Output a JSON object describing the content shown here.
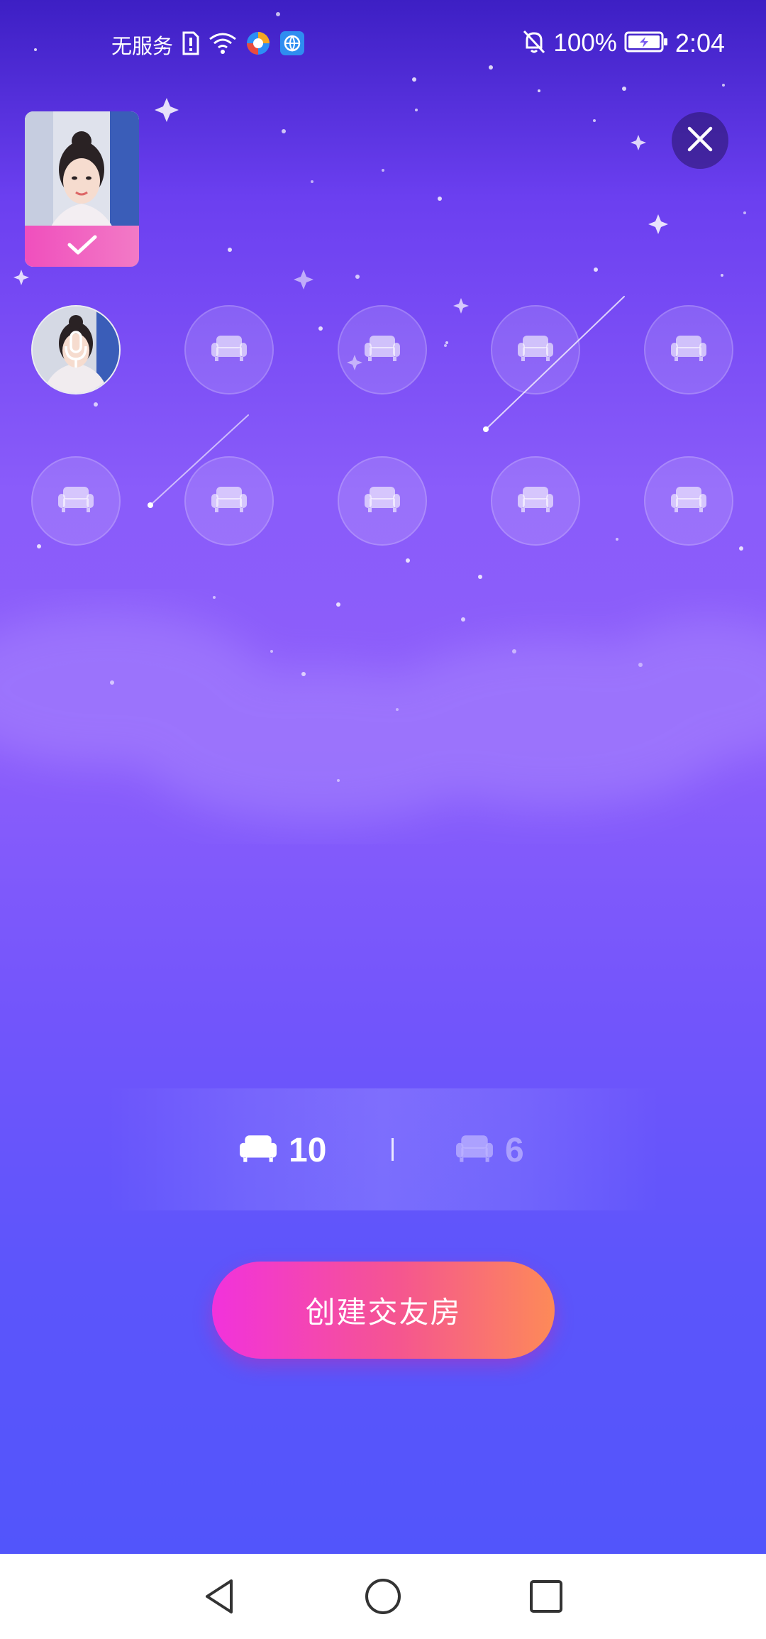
{
  "status_bar": {
    "carrier": "无服务",
    "battery": "100%",
    "time": "2:04"
  },
  "seat_options": [
    {
      "count": "10",
      "selected": true
    },
    {
      "count": "6",
      "selected": false
    }
  ],
  "create_button": {
    "label": "创建交友房"
  },
  "colors": {
    "accent_gradient_start": "#f232dc",
    "accent_gradient_end": "#fd8a58",
    "background_top": "#3d1fc4",
    "background_bottom": "#4f55fb"
  },
  "icons": {
    "seat": "sofa-icon",
    "close": "close-icon",
    "check": "check-icon",
    "mic": "microphone-icon"
  }
}
